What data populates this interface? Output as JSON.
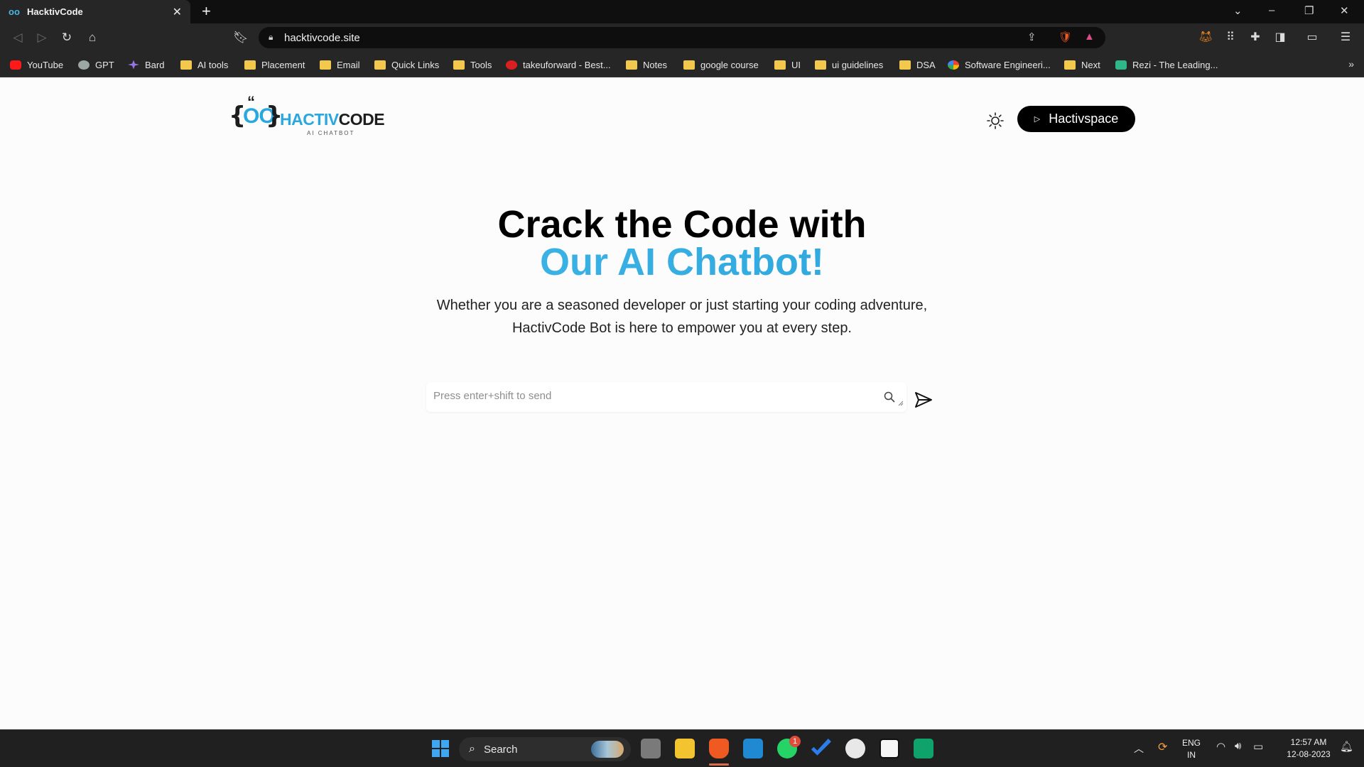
{
  "browser": {
    "tab_title": "HacktivCode",
    "tab_favicon": "oo",
    "url": "hacktivcode.site"
  },
  "bookmarks": [
    {
      "label": "YouTube",
      "icon": "youtube-icon"
    },
    {
      "label": "GPT",
      "icon": "chatgpt-icon"
    },
    {
      "label": "Bard",
      "icon": "bard-icon"
    },
    {
      "label": "AI tools",
      "icon": "folder-icon"
    },
    {
      "label": "Placement",
      "icon": "folder-icon"
    },
    {
      "label": "Email",
      "icon": "folder-icon"
    },
    {
      "label": "Quick Links",
      "icon": "folder-icon"
    },
    {
      "label": "Tools",
      "icon": "folder-icon"
    },
    {
      "label": "takeuforward - Best...",
      "icon": "takeuforward-icon"
    },
    {
      "label": "Notes",
      "icon": "folder-icon"
    },
    {
      "label": "google course",
      "icon": "folder-icon"
    },
    {
      "label": "UI",
      "icon": "folder-icon"
    },
    {
      "label": "ui guidelines",
      "icon": "folder-icon"
    },
    {
      "label": "DSA",
      "icon": "folder-icon"
    },
    {
      "label": "Software Engineeri...",
      "icon": "google-icon"
    },
    {
      "label": "Next",
      "icon": "folder-icon"
    },
    {
      "label": "Rezi - The Leading...",
      "icon": "rezi-icon"
    }
  ],
  "site": {
    "logo_brand": "HACTIV",
    "logo_brand_code": "CODE",
    "logo_tagline": "AI CHATBOT",
    "cta_label": "Hactivspace",
    "headline_line1": "Crack the Code with",
    "headline_line2": "Our AI Chatbot!",
    "description": "Whether you are a seasoned developer or just starting your coding adventure, HactivCode Bot is here to empower you at every step.",
    "input_placeholder": "Press enter+shift to send",
    "accent_color": "#29a8df"
  },
  "taskbar": {
    "search_label": "Search",
    "whatsapp_badge": "1",
    "language_line1": "ENG",
    "language_line2": "IN",
    "time": "12:57 AM",
    "date": "12-08-2023"
  }
}
